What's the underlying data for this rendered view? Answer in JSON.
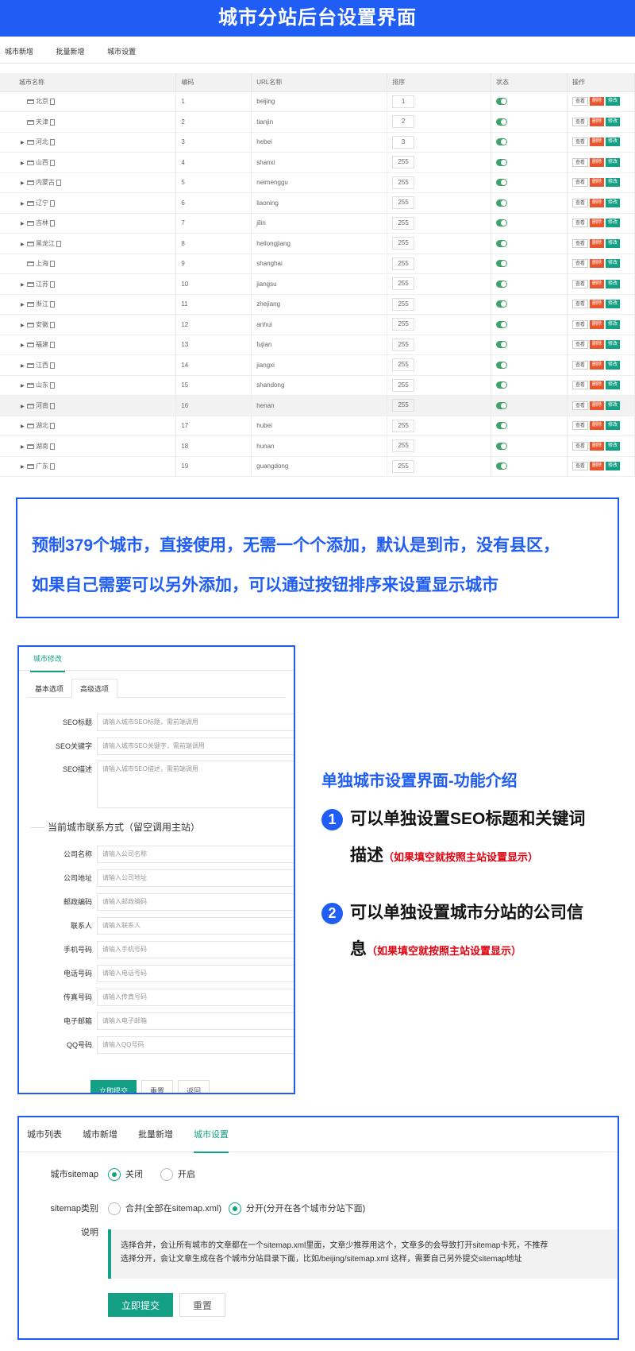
{
  "header": {
    "title": "城市分站后台设置界面"
  },
  "topnav": {
    "items": [
      "城市新增",
      "批量新增",
      "城市设置"
    ]
  },
  "cities_table": {
    "columns": [
      "城市名称",
      "编码",
      "URL名称",
      "排序",
      "状态",
      "操作"
    ],
    "op_labels": {
      "view": "查看",
      "delete": "删除",
      "edit": "修改"
    },
    "rows": [
      {
        "name": "北京",
        "code": "1",
        "url": "beijing",
        "sort": "1",
        "expandable": false
      },
      {
        "name": "天津",
        "code": "2",
        "url": "tianjin",
        "sort": "2",
        "expandable": false
      },
      {
        "name": "河北",
        "code": "3",
        "url": "hebei",
        "sort": "3",
        "expandable": true
      },
      {
        "name": "山西",
        "code": "4",
        "url": "shanxi",
        "sort": "255",
        "expandable": true
      },
      {
        "name": "内蒙古",
        "code": "5",
        "url": "neimenggu",
        "sort": "255",
        "expandable": true
      },
      {
        "name": "辽宁",
        "code": "6",
        "url": "liaoning",
        "sort": "255",
        "expandable": true
      },
      {
        "name": "吉林",
        "code": "7",
        "url": "jilin",
        "sort": "255",
        "expandable": true
      },
      {
        "name": "黑龙江",
        "code": "8",
        "url": "heilongjiang",
        "sort": "255",
        "expandable": true
      },
      {
        "name": "上海",
        "code": "9",
        "url": "shanghai",
        "sort": "255",
        "expandable": false
      },
      {
        "name": "江苏",
        "code": "10",
        "url": "jiangsu",
        "sort": "255",
        "expandable": true
      },
      {
        "name": "浙江",
        "code": "11",
        "url": "zhejiang",
        "sort": "255",
        "expandable": true
      },
      {
        "name": "安徽",
        "code": "12",
        "url": "anhui",
        "sort": "255",
        "expandable": true
      },
      {
        "name": "福建",
        "code": "13",
        "url": "fujian",
        "sort": "255",
        "expandable": true
      },
      {
        "name": "江西",
        "code": "14",
        "url": "jiangxi",
        "sort": "255",
        "expandable": true
      },
      {
        "name": "山东",
        "code": "15",
        "url": "shandong",
        "sort": "255",
        "expandable": true
      },
      {
        "name": "河南",
        "code": "16",
        "url": "henan",
        "sort": "255",
        "expandable": true
      },
      {
        "name": "湖北",
        "code": "17",
        "url": "hubei",
        "sort": "255",
        "expandable": true
      },
      {
        "name": "湖南",
        "code": "18",
        "url": "hunan",
        "sort": "255",
        "expandable": true
      },
      {
        "name": "广东",
        "code": "19",
        "url": "guangdong",
        "sort": "255",
        "expandable": true
      }
    ]
  },
  "note1": {
    "line1": "预制379个城市，直接使用，无需一个个添加，默认是到市，没有县区，",
    "line2": "如果自己需要可以另外添加，可以通过按钮排序来设置显示城市"
  },
  "city_form": {
    "tab": "城市修改",
    "subtabs": [
      "基本选项",
      "高级选项"
    ],
    "seo_fields": [
      {
        "label": "SEO标题",
        "placeholder": "请输入城市SEO标题，需前端调用"
      },
      {
        "label": "SEO关键字",
        "placeholder": "请输入城市SEO关键字，需前端调用"
      },
      {
        "label": "SEO描述",
        "placeholder": "请输入城市SEO描述，需前端调用"
      }
    ],
    "contact_group": "当前城市联系方式（留空调用主站）",
    "contact_fields": [
      {
        "label": "公司名称",
        "placeholder": "请输入公司名称"
      },
      {
        "label": "公司地址",
        "placeholder": "请输入公司地址"
      },
      {
        "label": "邮政编码",
        "placeholder": "请输入邮政编码"
      },
      {
        "label": "联系人",
        "placeholder": "请输入联系人"
      },
      {
        "label": "手机号码",
        "placeholder": "请输入手机号码"
      },
      {
        "label": "电话号码",
        "placeholder": "请输入电话号码"
      },
      {
        "label": "传真号码",
        "placeholder": "请输入传真号码"
      },
      {
        "label": "电子邮箱",
        "placeholder": "请输入电子邮箱"
      },
      {
        "label": "QQ号码",
        "placeholder": "请输入QQ号码"
      }
    ],
    "buttons": [
      "立即提交",
      "重置",
      "返回"
    ]
  },
  "features": {
    "title": "单独城市设置界面-功能介绍",
    "items": [
      {
        "num": "1",
        "text1": "可以单独设置SEO标题和关键词",
        "text2": "描述",
        "note": "（如果填空就按照主站设置显示）"
      },
      {
        "num": "2",
        "text1": "可以单独设置城市分站的公司信",
        "text2": "息",
        "note": "（如果填空就按照主站设置显示）"
      }
    ]
  },
  "settings": {
    "tabs": [
      "城市列表",
      "城市新增",
      "批量新增",
      "城市设置"
    ],
    "sitemap": {
      "label": "城市sitemap",
      "options": [
        "关闭",
        "开启"
      ],
      "selected": 0
    },
    "type": {
      "label": "sitemap类别",
      "options": [
        "合并(全部在sitemap.xml)",
        "分开(分开在各个城市分站下面)"
      ],
      "selected": 1
    },
    "desc_label": "说明",
    "desc_line1": "选择合并，会让所有城市的文章都在一个sitemap.xml里面，文章少推荐用这个，文章多的会导致打开sitemap卡死，不推荐",
    "desc_line2": "选择分开，会让文章生成在各个城市分站目录下面，比如/beijing/sitemap.xml 这样，需要自己另外提交sitemap地址",
    "buttons": [
      "立即提交",
      "重置"
    ]
  },
  "colors": {
    "brand": "#1f5df5",
    "primary": "#13a085",
    "danger": "#e8552c",
    "note_red": "#e0000f"
  }
}
